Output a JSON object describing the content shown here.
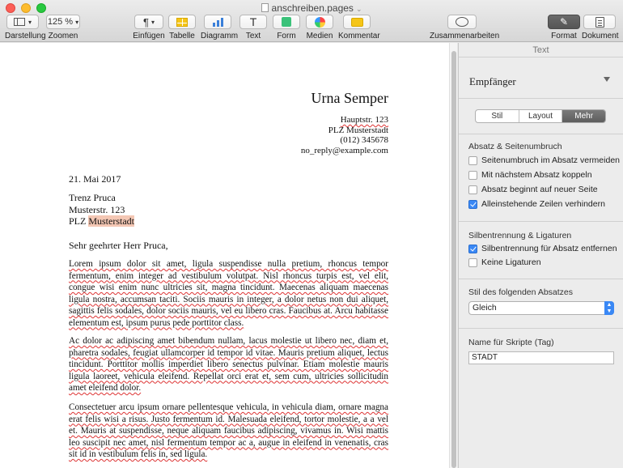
{
  "window": {
    "title": "anschreiben.pages"
  },
  "toolbar": {
    "darstellung": "Darstellung",
    "zoom_value": "125 %",
    "zoomen": "Zoomen",
    "einfuegen": "Einfügen",
    "tabelle": "Tabelle",
    "diagramm": "Diagramm",
    "text": "Text",
    "text_icon": "T",
    "form": "Form",
    "medien": "Medien",
    "kommentar": "Kommentar",
    "zusammenarbeiten": "Zusammenarbeiten",
    "format": "Format",
    "dokument": "Dokument"
  },
  "document": {
    "sender_name": "Urna Semper",
    "sender_street": "Hauptstr. 123",
    "sender_city": "PLZ Musterstadt",
    "sender_phone": "(012) 345678",
    "sender_email": "no_reply@example.com",
    "date": "21. Mai 2017",
    "recipient_name": "Trenz Pruca",
    "recipient_street": "Musterstr. 123",
    "recipient_plz": "PLZ",
    "recipient_city": "Musterstadt",
    "salutation": "Sehr geehrter Herr Pruca,",
    "paragraph1": "Lorem ipsum dolor sit amet, ligula suspendisse nulla pretium, rhoncus tempor fermentum, enim integer ad vestibulum volutpat. Nisl rhoncus turpis est, vel elit, congue wisi enim nunc ultricies sit, magna tincidunt. Maecenas aliquam maecenas ligula nostra, accumsan taciti. Sociis mauris in integer, a dolor netus non dui aliquet, sagittis felis sodales, dolor sociis mauris, vel eu libero cras. Faucibus at. Arcu habitasse elementum est, ipsum purus pede porttitor class.",
    "paragraph2": "Ac dolor ac adipiscing amet bibendum nullam, lacus molestie ut libero nec, diam et, pharetra sodales, feugiat ullamcorper id tempor id vitae. Mauris pretium aliquet, lectus tincidunt. Porttitor mollis imperdiet libero senectus pulvinar. Etiam molestie mauris ligula laoreet, vehicula eleifend. Repellat orci erat et, sem cum, ultricies sollicitudin amet eleifend dolor.",
    "paragraph3": "Consectetuer arcu ipsum ornare pellentesque vehicula, in vehicula diam, ornare magna erat felis wisi a risus. Justo fermentum id. Malesuada eleifend, tortor molestie, a a vel et. Mauris at suspendisse, neque aliquam faucibus adipiscing, vivamus in. Wisi mattis leo suscipit nec amet, nisl fermentum tempor ac a, augue in eleifend in venenatis, cras sit id in vestibulum felis in, sed ligula."
  },
  "inspector": {
    "header": "Text",
    "style_name": "Empfänger",
    "tabs": [
      "Stil",
      "Layout",
      "Mehr"
    ],
    "selected_tab": "Mehr",
    "section1_title": "Absatz & Seitenumbruch",
    "options1": [
      {
        "label": "Seitenumbruch im Absatz vermeiden",
        "checked": false
      },
      {
        "label": "Mit nächstem Absatz koppeln",
        "checked": false
      },
      {
        "label": "Absatz beginnt auf neuer Seite",
        "checked": false
      },
      {
        "label": "Alleinstehende Zeilen verhindern",
        "checked": true
      }
    ],
    "section2_title": "Silbentrennung & Ligaturen",
    "options2": [
      {
        "label": "Silbentrennung für Absatz entfernen",
        "checked": true
      },
      {
        "label": "Keine Ligaturen",
        "checked": false
      }
    ],
    "section3_title": "Stil des folgenden Absatzes",
    "next_style_value": "Gleich",
    "section4_title": "Name für Skripte (Tag)",
    "tag_value": "STADT"
  }
}
